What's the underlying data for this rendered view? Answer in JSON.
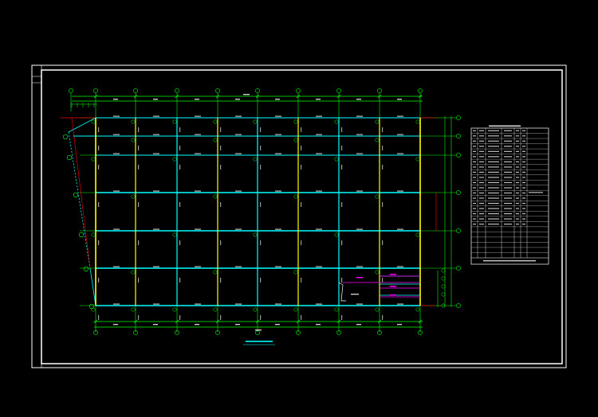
{
  "drawing": {
    "title_block_label": "",
    "plan_title": "",
    "table_title": "",
    "table_note": "",
    "colors": {
      "background": "#000000",
      "frame": "#ffffff",
      "grid": "#00ff00",
      "beam": "#00ffff",
      "column": "#ffff00",
      "bracing": "#ff00ff",
      "axis_edge": "#ff0000"
    },
    "top_axes": [
      "",
      "",
      "",
      "",
      "",
      "",
      "",
      "",
      "",
      ""
    ],
    "side_axes": [
      "",
      "",
      "",
      "",
      "",
      ""
    ],
    "table_rows": 25
  }
}
